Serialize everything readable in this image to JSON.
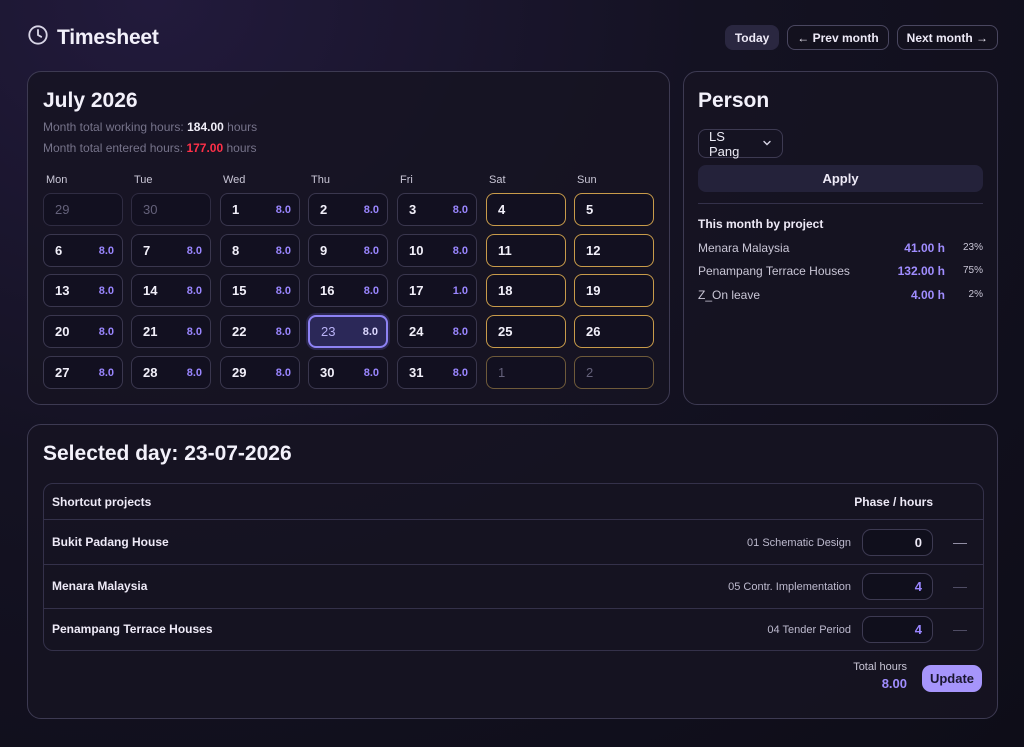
{
  "app": {
    "title": "Timesheet",
    "icon": "clock-icon"
  },
  "nav": {
    "today": "Today",
    "prev": "← Prev month",
    "next": "Next month →"
  },
  "calendar": {
    "title": "July 2026",
    "working_label": "Month total working hours:",
    "working_value": "184.00",
    "entered_label": "Month total entered hours:",
    "entered_value": "177.00",
    "unit": "hours",
    "dow": [
      "Mon",
      "Tue",
      "Wed",
      "Thu",
      "Fri",
      "Sat",
      "Sun"
    ],
    "weeks": [
      [
        {
          "d": "29",
          "h": "",
          "other": true
        },
        {
          "d": "30",
          "h": "",
          "other": true
        },
        {
          "d": "1",
          "h": "8.0"
        },
        {
          "d": "2",
          "h": "8.0"
        },
        {
          "d": "3",
          "h": "8.0"
        },
        {
          "d": "4",
          "h": "",
          "weekend": true
        },
        {
          "d": "5",
          "h": "",
          "weekend": true
        }
      ],
      [
        {
          "d": "6",
          "h": "8.0"
        },
        {
          "d": "7",
          "h": "8.0"
        },
        {
          "d": "8",
          "h": "8.0"
        },
        {
          "d": "9",
          "h": "8.0"
        },
        {
          "d": "10",
          "h": "8.0"
        },
        {
          "d": "11",
          "h": "",
          "weekend": true
        },
        {
          "d": "12",
          "h": "",
          "weekend": true
        }
      ],
      [
        {
          "d": "13",
          "h": "8.0"
        },
        {
          "d": "14",
          "h": "8.0"
        },
        {
          "d": "15",
          "h": "8.0"
        },
        {
          "d": "16",
          "h": "8.0"
        },
        {
          "d": "17",
          "h": "1.0"
        },
        {
          "d": "18",
          "h": "",
          "weekend": true
        },
        {
          "d": "19",
          "h": "",
          "weekend": true
        }
      ],
      [
        {
          "d": "20",
          "h": "8.0"
        },
        {
          "d": "21",
          "h": "8.0"
        },
        {
          "d": "22",
          "h": "8.0"
        },
        {
          "d": "23",
          "h": "8.0",
          "selected": true
        },
        {
          "d": "24",
          "h": "8.0"
        },
        {
          "d": "25",
          "h": "",
          "weekend": true
        },
        {
          "d": "26",
          "h": "",
          "weekend": true
        }
      ],
      [
        {
          "d": "27",
          "h": "8.0"
        },
        {
          "d": "28",
          "h": "8.0"
        },
        {
          "d": "29",
          "h": "8.0"
        },
        {
          "d": "30",
          "h": "8.0"
        },
        {
          "d": "31",
          "h": "8.0"
        },
        {
          "d": "1",
          "h": "",
          "weekend": true,
          "other": true
        },
        {
          "d": "2",
          "h": "",
          "weekend": true,
          "other": true
        }
      ]
    ]
  },
  "person": {
    "title": "Person",
    "selected": "LS Pang",
    "apply": "Apply",
    "subtitle": "This month by project",
    "projects": [
      {
        "name": "Menara Malaysia",
        "hours": "41.00 h",
        "pct": "23%"
      },
      {
        "name": "Penampang Terrace Houses",
        "hours": "132.00 h",
        "pct": "75%"
      },
      {
        "name": "Z_On leave",
        "hours": "4.00 h",
        "pct": "2%"
      }
    ]
  },
  "day": {
    "title": "Selected day: 23-07-2026",
    "col_project": "Shortcut projects",
    "col_phase": "Phase / hours",
    "rows": [
      {
        "project": "Bukit Padang House",
        "phase": "01 Schematic Design",
        "hours": "0",
        "remove": "—"
      },
      {
        "project": "Menara Malaysia",
        "phase": "05 Contr. Implementation",
        "hours": "4",
        "remove": "—"
      },
      {
        "project": "Penampang Terrace Houses",
        "phase": "04 Tender Period",
        "hours": "4",
        "remove": "—"
      }
    ],
    "total_label": "Total hours",
    "total_value": "8.00",
    "update": "Update"
  },
  "colors": {
    "accent": "#a695fb",
    "weekend": "#c89b4a",
    "alert": "#ff3048"
  }
}
